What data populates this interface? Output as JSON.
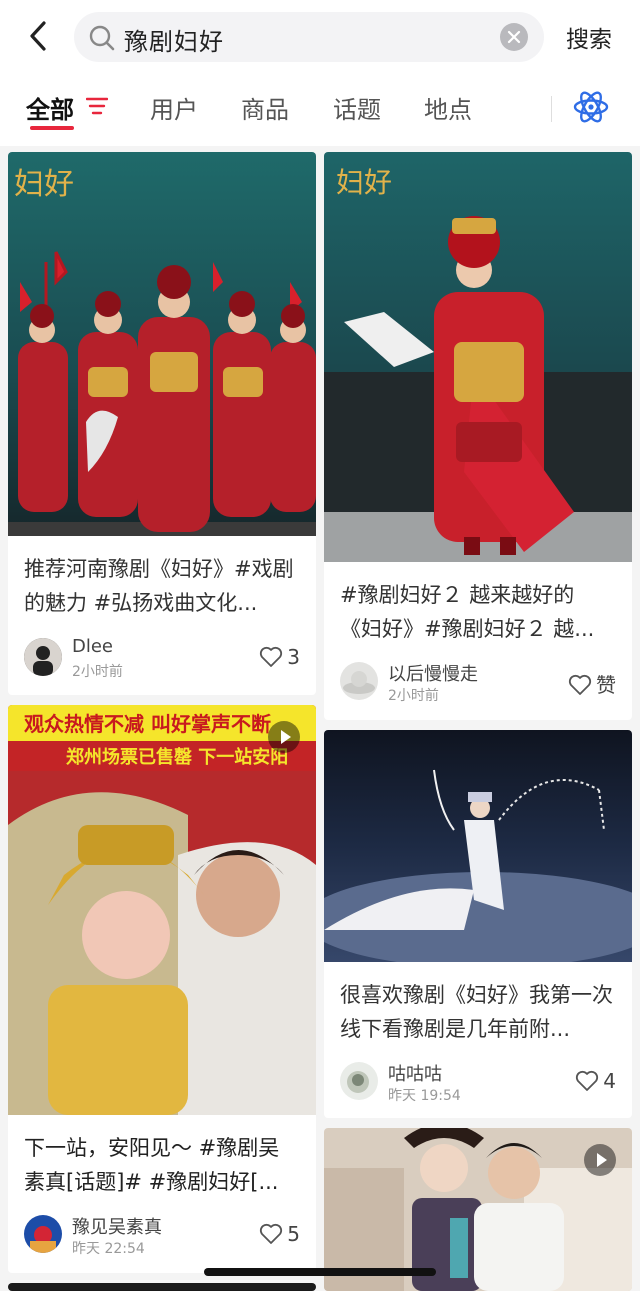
{
  "search": {
    "query": "豫剧妇好",
    "search_button": "搜索"
  },
  "tabs": [
    {
      "label": "全部",
      "active": true
    },
    {
      "label": "用户",
      "active": false
    },
    {
      "label": "商品",
      "active": false
    },
    {
      "label": "话题",
      "active": false
    },
    {
      "label": "地点",
      "active": false
    }
  ],
  "colors": {
    "accent": "#e8263c",
    "atom_icon": "#2f6de6"
  },
  "posts": [
    {
      "title": "推荐河南豫剧《妇好》#戏剧的魅力 #弘扬戏曲文化...",
      "author": "Dlee",
      "time": "2小时前",
      "likes": "3",
      "image_text": "妇好"
    },
    {
      "title": "#豫剧妇好２ 越来越好的《妇好》#豫剧妇好２ 越...",
      "author": "以后慢慢走",
      "time": "2小时前",
      "likes": "赞",
      "image_text": "妇好"
    },
    {
      "title": "下一站，安阳见～ #豫剧吴素真[话题]# #豫剧妇好[...",
      "author": "豫见吴素真",
      "time": "昨天 22:54",
      "likes": "5",
      "banner_top": "观众热情不减 叫好掌声不断",
      "banner_bottom": "郑州场票已售罄 下一站安阳"
    },
    {
      "title": "很喜欢豫剧《妇好》我第一次线下看豫剧是几年前附...",
      "author": "咕咕咕",
      "time": "昨天 19:54",
      "likes": "4"
    }
  ]
}
